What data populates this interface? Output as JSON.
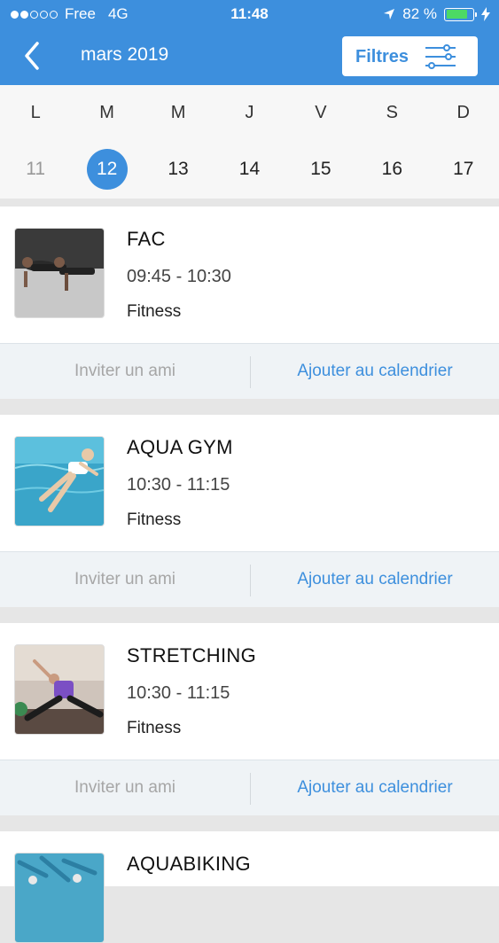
{
  "status_bar": {
    "carrier": "Free",
    "network": "4G",
    "time": "11:48",
    "battery": "82 %",
    "battery_level": 0.82
  },
  "nav": {
    "title": "mars 2019",
    "filters_label": "Filtres",
    "accent_color": "#3d8fdd"
  },
  "week": {
    "days": [
      "L",
      "M",
      "M",
      "J",
      "V",
      "S",
      "D"
    ],
    "dates": [
      "11",
      "12",
      "13",
      "14",
      "15",
      "16",
      "17"
    ],
    "selected_date": "12"
  },
  "classes": [
    {
      "title": "FAC",
      "time": "09:45 - 10:30",
      "category": "Fitness",
      "invite": "Inviter un ami",
      "add": "Ajouter au calendrier"
    },
    {
      "title": "AQUA GYM",
      "time": "10:30 - 11:15",
      "category": "Fitness",
      "invite": "Inviter un ami",
      "add": "Ajouter au calendrier"
    },
    {
      "title": "STRETCHING",
      "time": "10:30 - 11:15",
      "category": "Fitness",
      "invite": "Inviter un ami",
      "add": "Ajouter au calendrier"
    },
    {
      "title": "AQUABIKING"
    }
  ]
}
